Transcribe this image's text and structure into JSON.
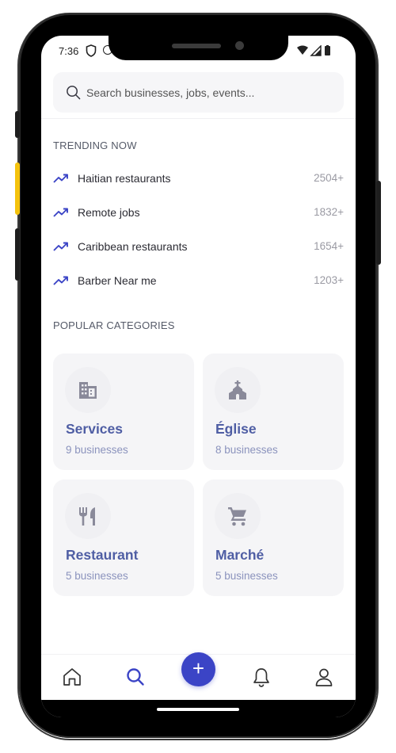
{
  "status_bar": {
    "time": "7:36"
  },
  "search": {
    "placeholder": "Search businesses, jobs, events..."
  },
  "trending": {
    "title": "TRENDING NOW",
    "items": [
      {
        "label": "Haitian restaurants",
        "count": "2504+"
      },
      {
        "label": "Remote jobs",
        "count": "1832+"
      },
      {
        "label": "Caribbean restaurants",
        "count": "1654+"
      },
      {
        "label": "Barber Near me",
        "count": "1203+"
      }
    ]
  },
  "categories": {
    "title": "POPULAR CATEGORIES",
    "items": [
      {
        "name": "Services",
        "count": "9 businesses",
        "icon": "building-icon"
      },
      {
        "name": "Église",
        "count": "8 businesses",
        "icon": "church-icon"
      },
      {
        "name": "Restaurant",
        "count": "5 businesses",
        "icon": "restaurant-icon"
      },
      {
        "name": "Marché",
        "count": "5 businesses",
        "icon": "cart-icon"
      }
    ]
  },
  "bottom_nav": {
    "items": [
      "home-icon",
      "search-icon",
      "bell-icon",
      "profile-icon"
    ],
    "active": "search-icon",
    "fab_label": "+"
  },
  "colors": {
    "accent": "#3b44c6",
    "card_title": "#4f5ea4",
    "card_sub": "#8b93bd",
    "icon_gray": "#8a8a9a"
  }
}
